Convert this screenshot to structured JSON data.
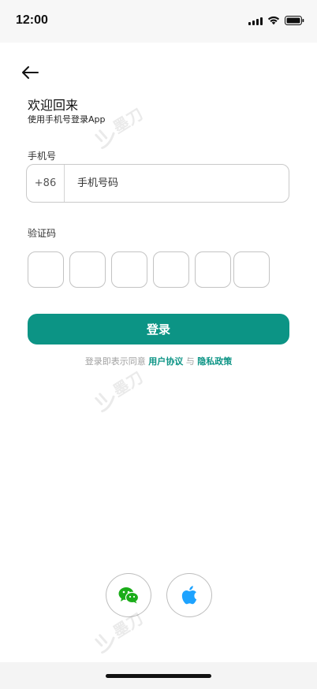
{
  "status_bar": {
    "time": "12:00",
    "icons": [
      "signal-icon",
      "wifi-icon",
      "battery-icon"
    ]
  },
  "header": {
    "back_icon": "arrow-left-icon",
    "title": "欢迎回来",
    "subtitle": "使用手机号登录App"
  },
  "phone": {
    "label": "手机号",
    "country_code": "+86",
    "placeholder": "手机号码",
    "value": ""
  },
  "verification": {
    "label": "验证码",
    "digits": [
      "",
      "",
      "",
      "",
      "",
      ""
    ]
  },
  "login_button": {
    "label": "登录"
  },
  "agreement": {
    "prefix": "登录即表示同意",
    "user_agreement": "用户协议",
    "conjunction": "与",
    "privacy_policy": "隐私政策"
  },
  "social_login": [
    {
      "name": "wechat",
      "icon": "wechat-icon"
    },
    {
      "name": "apple",
      "icon": "apple-icon"
    }
  ],
  "watermark": {
    "text": "墨刀"
  },
  "colors": {
    "accent": "#0c9485",
    "wechat": "#1aad19",
    "apple": "#1ea3ff",
    "border": "#c3c3c3"
  }
}
